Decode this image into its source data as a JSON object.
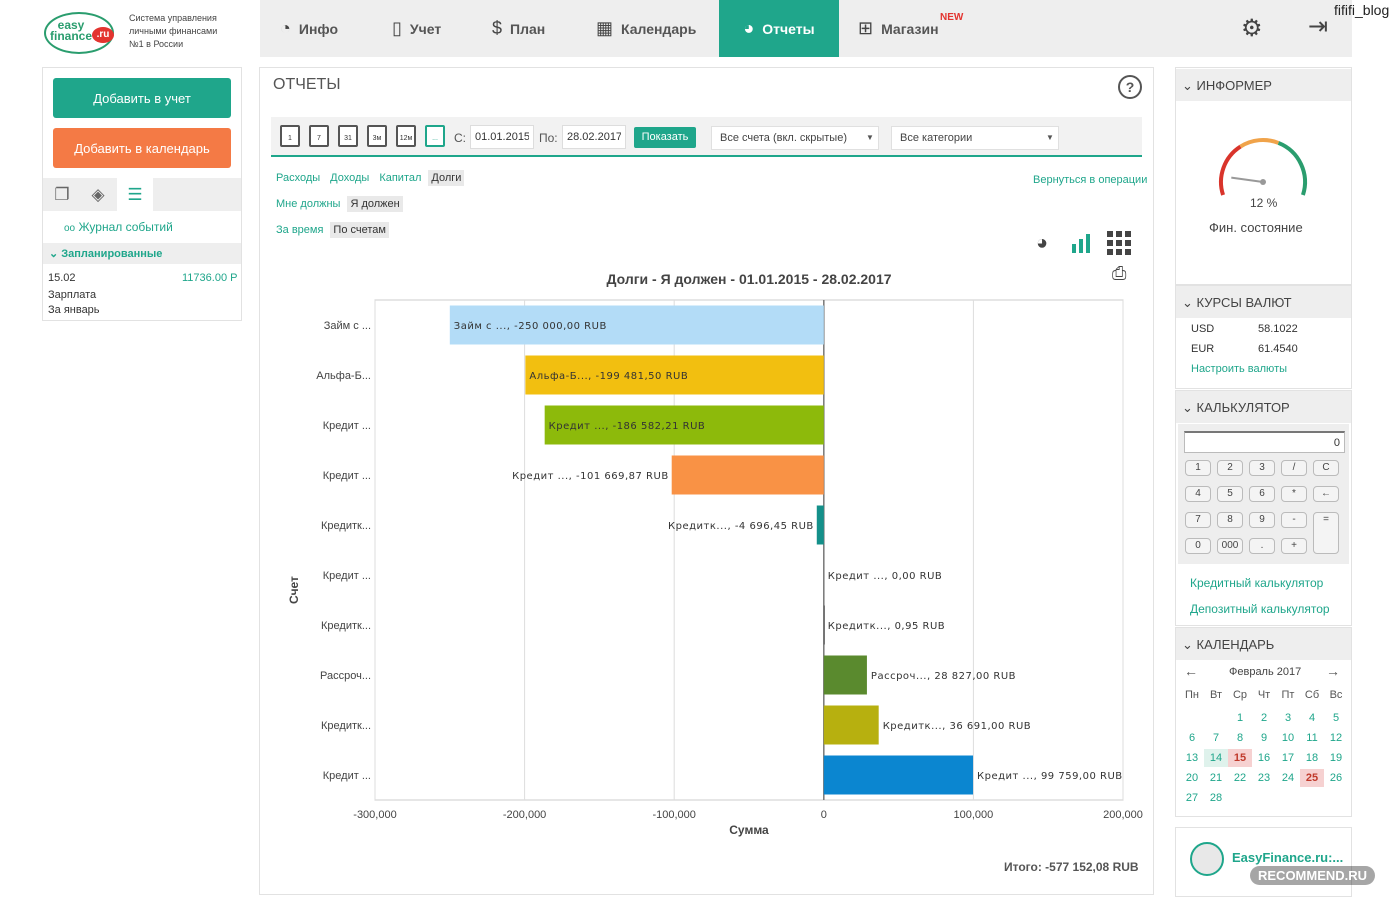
{
  "brand": {
    "logo_word": "easy finance",
    "logo_ru": ".ru",
    "tagline_1": "Система управления",
    "tagline_2": "личными финансами",
    "tagline_3": "№1 в России"
  },
  "nav": {
    "items": [
      {
        "label": "Инфо",
        "icon": "speedometer-icon"
      },
      {
        "label": "Учет",
        "icon": "book-icon"
      },
      {
        "label": "План",
        "icon": "money-bag-icon"
      },
      {
        "label": "Календарь",
        "icon": "calendar-icon"
      },
      {
        "label": "Отчеты",
        "icon": "pie-chart-icon"
      },
      {
        "label": "Магазин",
        "icon": "gift-icon"
      }
    ],
    "new_badge": "NEW",
    "corner_label": "fififi_blog"
  },
  "left": {
    "add_account_btn": "Добавить в учет",
    "add_calendar_btn": "Добавить в календарь",
    "journal_link": "Журнал событий",
    "planned_header": "Запланированные",
    "planned": {
      "date": "15.02",
      "amount": "11736.00 Р",
      "desc_1": "Зарплата",
      "desc_2": "За январь"
    }
  },
  "reports": {
    "title": "ОТЧЕТЫ",
    "help": "?",
    "period_buttons": [
      "1",
      "7",
      "31",
      "3м",
      "12м",
      "..."
    ],
    "from_label": "С:",
    "from_value": "01.01.2015",
    "to_label": "По:",
    "to_value": "28.02.2017",
    "show_btn": "Показать",
    "accounts_select": "Все счета (вкл. скрытые)",
    "categories_select": "Все категории",
    "type_filters": [
      "Расходы",
      "Доходы",
      "Капитал",
      "Долги"
    ],
    "debt_filters": [
      "Мне должны",
      "Я должен"
    ],
    "time_filters": [
      "За время",
      "По счетам"
    ],
    "return_link": "Вернуться в операции",
    "total": "Итого: -577 152,08 RUB"
  },
  "chart_data": {
    "type": "bar",
    "orientation": "horizontal",
    "title": "Долги - Я должен - 01.01.2015 - 28.02.2017",
    "xlabel": "Сумма",
    "ylabel": "Счет",
    "xlim": [
      -300000,
      200000
    ],
    "x_ticks": [
      "-300,000",
      "-200,000",
      "-100,000",
      "0",
      "100,000",
      "200,000"
    ],
    "grid": true,
    "categories": [
      "Займ с ...",
      "Альфа-Б...",
      "Кредит ...",
      "Кредит ...",
      "Кредитк...",
      "Кредит ...",
      "Кредитк...",
      "Рассроч...",
      "Кредитк...",
      "Кредит ..."
    ],
    "values": [
      -250000.0,
      -199481.5,
      -186582.21,
      -101669.87,
      -4696.45,
      0.0,
      0.95,
      28827.0,
      36691.0,
      99759.0
    ],
    "data_labels": [
      "Займ с ..., -250 000,00 RUB",
      "Альфа-Б..., -199 481,50 RUB",
      "Кредит ..., -186 582,21 RUB",
      "Кредит ..., -101 669,87 RUB",
      "Кредитк..., -4 696,45 RUB",
      "Кредит ..., 0,00 RUB",
      "Кредитк..., 0,95 RUB",
      "Рассроч..., 28 827,00 RUB",
      "Кредитк..., 36 691,00 RUB",
      "Кредит ..., 99 759,00 RUB"
    ],
    "colors": [
      "#b3dcf7",
      "#f2bf10",
      "#8dba0b",
      "#f99245",
      "#14908a",
      "#555555",
      "#555555",
      "#5a8a2e",
      "#b7b00f",
      "#0b86d0"
    ]
  },
  "right": {
    "informer_header": "ИНФОРМЕР",
    "gauge_value": "12 %",
    "gauge_fraction": 0.12,
    "gauge_label": "Фин. состояние",
    "rates_header": "КУРСЫ ВАЛЮТ",
    "rates": [
      {
        "code": "USD",
        "value": "58.1022"
      },
      {
        "code": "EUR",
        "value": "61.4540"
      }
    ],
    "rates_link": "Настроить валюты",
    "calc_header": "КАЛЬКУЛЯТОР",
    "calc_display": "0",
    "calc_keys": [
      [
        "1",
        "2",
        "3",
        "/",
        "C"
      ],
      [
        "4",
        "5",
        "6",
        "*",
        "←"
      ],
      [
        "7",
        "8",
        "9",
        "-",
        "="
      ],
      [
        "0",
        "000",
        ".",
        "+"
      ]
    ],
    "credit_calc_link": "Кредитный калькулятор",
    "deposit_calc_link": "Депозитный калькулятор",
    "calendar_header": "КАЛЕНДАРЬ",
    "calendar_month": "Февраль 2017",
    "calendar_prev": "←",
    "calendar_next": "→",
    "calendar_dow": [
      "Пн",
      "Вт",
      "Ср",
      "Чт",
      "Пт",
      "Сб",
      "Вс"
    ],
    "calendar_weeks": [
      [
        "",
        "",
        "1",
        "2",
        "3",
        "4",
        "5"
      ],
      [
        "6",
        "7",
        "8",
        "9",
        "10",
        "11",
        "12"
      ],
      [
        "13",
        "14",
        "15",
        "16",
        "17",
        "18",
        "19"
      ],
      [
        "20",
        "21",
        "22",
        "23",
        "24",
        "25",
        "26"
      ],
      [
        "27",
        "28",
        "",
        "",
        "",
        "",
        ""
      ]
    ],
    "promo_text": "EasyFinance.ru:...",
    "watermark": "RECOMMEND.RU"
  }
}
